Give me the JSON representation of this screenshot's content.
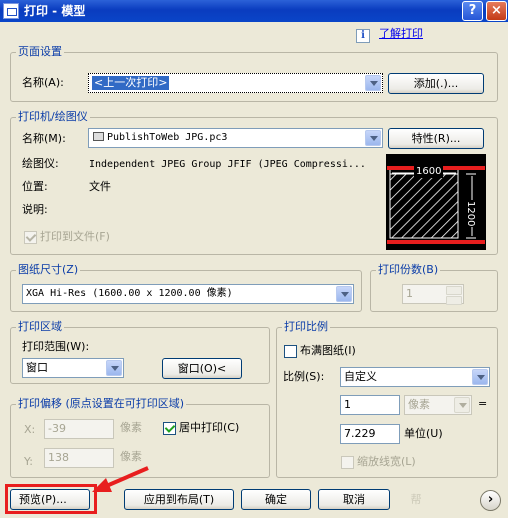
{
  "window": {
    "title": "打印 - 模型",
    "help": "?",
    "close": "×"
  },
  "help_link": "了解打印",
  "info_icon": "i",
  "page_setup": {
    "group": "页面设置",
    "name_label": "名称(A):",
    "name_value": "<上一次打印>",
    "add_button": "添加(.)..."
  },
  "printer": {
    "group": "打印机/绘图仪",
    "name_label": "名称(M):",
    "name_value": "PublishToWeb JPG.pc3",
    "properties_button": "特性(R)...",
    "plotter_label": "绘图仪:",
    "plotter_value": "Independent JPEG Group JFIF (JPEG Compressi...",
    "location_label": "位置:",
    "location_value": "文件",
    "desc_label": "说明:",
    "print_to_file": "打印到文件(F)",
    "preview_width": "1600",
    "preview_height": "1200"
  },
  "paper_size": {
    "group": "图纸尺寸(Z)",
    "value": "XGA Hi-Res (1600.00 x 1200.00 像素)"
  },
  "copies": {
    "group": "打印份数(B)",
    "value": "1"
  },
  "plot_area": {
    "group": "打印区域",
    "range_label": "打印范围(W):",
    "range_value": "窗口",
    "window_button": "窗口(O)<"
  },
  "plot_offset": {
    "group": "打印偏移 (原点设置在可打印区域)",
    "x_label": "X:",
    "x_value": "-39",
    "x_unit": "像素",
    "y_label": "Y:",
    "y_value": "138",
    "y_unit": "像素",
    "center_label": "居中打印(C)"
  },
  "plot_scale": {
    "group": "打印比例",
    "fit_paper": "布满图纸(I)",
    "scale_label": "比例(S):",
    "scale_value": "自定义",
    "value1": "1",
    "unit1": "像素",
    "equals": "=",
    "value2": "7.229",
    "unit2": "单位(U)",
    "scale_lineweights": "缩放线宽(L)"
  },
  "buttons": {
    "preview": "预览(P)...",
    "apply": "应用到布局(T)",
    "ok": "确定",
    "cancel": "取消",
    "help": "帮"
  },
  "more_icon": "›"
}
